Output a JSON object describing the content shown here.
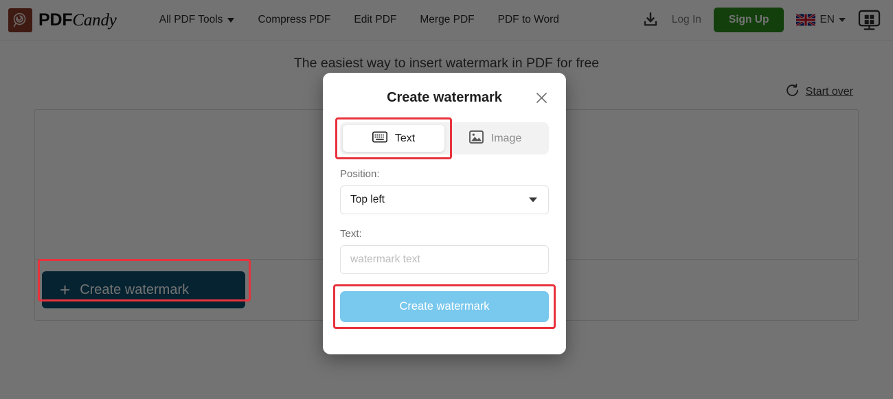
{
  "header": {
    "logo": {
      "name": "pdfcandy-logo",
      "text_bold": "PDF",
      "text_italic": "Candy"
    },
    "nav": [
      {
        "label": "All PDF Tools",
        "has_caret": true
      },
      {
        "label": "Compress PDF",
        "has_caret": false
      },
      {
        "label": "Edit PDF",
        "has_caret": false
      },
      {
        "label": "Merge PDF",
        "has_caret": false
      },
      {
        "label": "PDF to Word",
        "has_caret": false
      }
    ],
    "download_icon": "download-icon",
    "login_label": "Log In",
    "signup_label": "Sign Up",
    "language": {
      "code": "EN",
      "flag": "uk-flag-icon"
    },
    "desktop_app_icon": "windows-desktop-icon",
    "signup_color": "#2a8c1e"
  },
  "page": {
    "subtitle": "The easiest way to insert watermark in PDF for free",
    "start_over_label": "Start over",
    "start_over_icon": "reset-circular-arrow-icon",
    "main_button_label": "Create watermark",
    "main_button_plus": "+",
    "main_button_color": "#0d4f6e"
  },
  "modal": {
    "title": "Create watermark",
    "close_icon": "close-icon",
    "tabs": [
      {
        "label": "Text",
        "icon": "keyboard-icon",
        "active": true
      },
      {
        "label": "Image",
        "icon": "image-icon",
        "active": false
      }
    ],
    "position_label": "Position:",
    "position_value": "Top left",
    "position_options": [
      "Top left"
    ],
    "text_label": "Text:",
    "text_value": "",
    "text_placeholder": "watermark text",
    "submit_label": "Create watermark",
    "submit_color": "#79c8ee"
  },
  "annotations": {
    "highlight_color": "#e8323c"
  }
}
